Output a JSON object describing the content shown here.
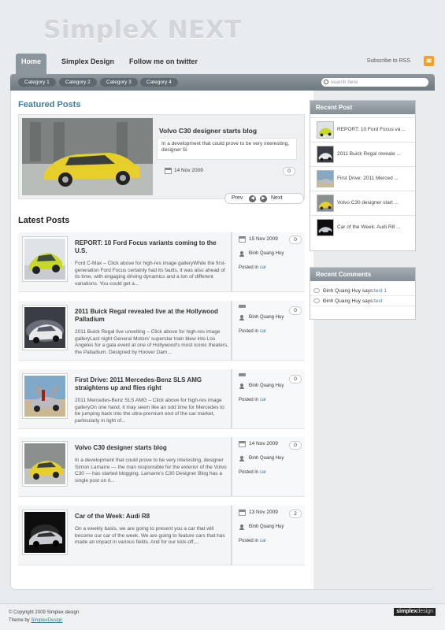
{
  "site": {
    "title": "SimpleX NEXT"
  },
  "topnav": {
    "items": [
      {
        "label": "Home"
      },
      {
        "label": "Simplex Design"
      },
      {
        "label": "Follow me on twitter"
      }
    ],
    "rss_label": "Subscribe to RSS"
  },
  "categories": [
    "Category 1",
    "Category 2",
    "Category 3",
    "Category 4"
  ],
  "search": {
    "placeholder": "search here"
  },
  "featured": {
    "heading": "Featured Posts",
    "title": "Volvo C30 designer starts blog",
    "excerpt": "In a development that could prove to be very interesting, designer Si",
    "date": "14 Nov 2009",
    "comments": "0",
    "prev_label": "Prev",
    "next_label": "Next"
  },
  "latest": {
    "heading": "Latest Posts",
    "posts": [
      {
        "title": "REPORT: 10 Ford Focus variants coming to the U.S.",
        "excerpt": "Ford C-Max – Click above for high-res image galleryWhile the first-generation Ford Focus certainly had its faults, it was also ahead of its time, with engaging driving dynamics and a ton of different variations. You could get a...",
        "date": "15 Nov 2009",
        "author": "Đinh Quang Huy",
        "posted_in": "Posted in",
        "category": "car",
        "comments": "0"
      },
      {
        "title": "2011 Buick Regal revealed live at the Hollywood Palladium",
        "excerpt": "2011 Buick Regal live unveiling – Click above for high-res image galleryLast night General Motors' superstar train blew into Los Angeles for a gala event at one of Hollywood's most iconic theaters, the Palladium. Designed by Hoover Dam...",
        "date": "",
        "author": "Đinh Quang Huy",
        "posted_in": "Posted in",
        "category": "car",
        "comments": "0"
      },
      {
        "title": "First Drive: 2011 Mercedes-Benz SLS AMG straightens up and flies right",
        "excerpt": "2011 Mercedes-Benz SLS AMG – Click above for high-res image galleryOn one hand, it may seem like an odd time for Mercedes to be jumping back into the ultra-premium end of the car market, particularly in light of...",
        "date": "",
        "author": "Đinh Quang Huy",
        "posted_in": "Posted in",
        "category": "car",
        "comments": "0"
      },
      {
        "title": "Volvo C30 designer starts blog",
        "excerpt": "In a development that could prove to be very interesting, designer Simon Lamarre — the man responsible for the exterior of the Volvo C30 — has started blogging. Lamarre's C30 Designer Blog has a single post on it...",
        "date": "14 Nov 2009",
        "author": "Đinh Quang Huy",
        "posted_in": "Posted in",
        "category": "car",
        "comments": "0"
      },
      {
        "title": "Car of the Week: Audi R8",
        "excerpt": "On a weekly basis, we are going to present you a car that will become our car of the week. We are going to feature cars that has made an impact in various fields. And for our kick-off,...",
        "date": "13 Nov 2009",
        "author": "Đinh Quang Huy",
        "posted_in": "Posted in",
        "category": "car",
        "comments": "2"
      }
    ]
  },
  "recent_posts": {
    "heading": "Recent Post",
    "items": [
      "REPORT: 10 Ford Focus va ...",
      "2011 Buick Regal reveale ...",
      "First Drive: 2011 Merced ...",
      "Volvo C30 designer start ...",
      "Car of the Week: Audi R8 ..."
    ]
  },
  "recent_comments": {
    "heading": "Recent Comments",
    "items": [
      {
        "author": "Đinh Quang Huy says:",
        "text": "test 1"
      },
      {
        "author": "Đinh Quang Huy says:",
        "text": "test"
      }
    ]
  },
  "footer": {
    "copyright": "© Copyright 2009 Simplex design",
    "theme_by": "Theme by",
    "theme_link": "SimplexDesign",
    "logo_a": "simplex",
    "logo_b": "design"
  }
}
